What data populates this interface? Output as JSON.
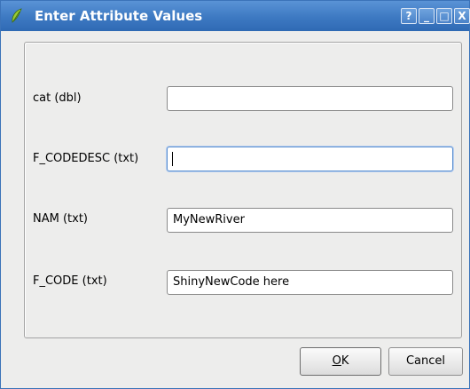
{
  "window": {
    "title": "Enter Attribute Values",
    "controls": {
      "help": "?",
      "minimize": "_",
      "maximize": "□",
      "close": "X"
    }
  },
  "fields": [
    {
      "label": "cat (dbl)",
      "value": ""
    },
    {
      "label": "F_CODEDESC (txt)",
      "value": ""
    },
    {
      "label": "NAM (txt)",
      "value": "MyNewRiver"
    },
    {
      "label": "F_CODE (txt)",
      "value": "ShinyNewCode here"
    }
  ],
  "buttons": {
    "ok_mnemonic": "O",
    "ok_rest": "K",
    "cancel": "Cancel"
  },
  "colors": {
    "titlebar": "#3d79c2",
    "dialog_bg": "#ededec"
  }
}
